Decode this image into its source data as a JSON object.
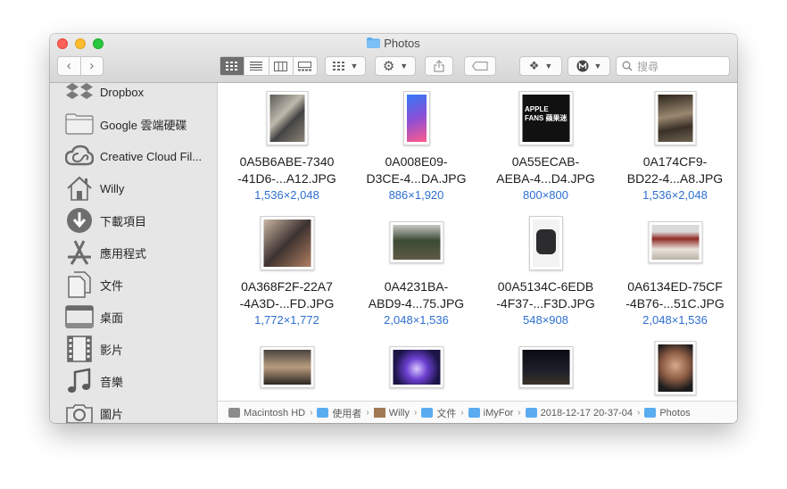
{
  "window": {
    "title": "Photos"
  },
  "toolbar": {
    "back": "‹",
    "forward": "›",
    "search_placeholder": "搜尋"
  },
  "sidebar": {
    "items": [
      {
        "label": "Dropbox",
        "icon": "dropbox-icon"
      },
      {
        "label": "Google 雲端硬碟",
        "icon": "folder-icon"
      },
      {
        "label": "Creative Cloud Fil...",
        "icon": "creative-cloud-icon"
      },
      {
        "label": "Willy",
        "icon": "home-icon"
      },
      {
        "label": "下載項目",
        "icon": "download-icon"
      },
      {
        "label": "應用程式",
        "icon": "applications-icon"
      },
      {
        "label": "文件",
        "icon": "documents-icon"
      },
      {
        "label": "桌面",
        "icon": "desktop-icon"
      },
      {
        "label": "影片",
        "icon": "movies-icon"
      },
      {
        "label": "音樂",
        "icon": "music-icon"
      },
      {
        "label": "圖片",
        "icon": "pictures-icon"
      }
    ]
  },
  "files": [
    {
      "line1": "0A5B6ABE-7340",
      "line2": "-41D6-...A12.JPG",
      "dims": "1,536×2,048"
    },
    {
      "line1": "0A008E09-",
      "line2": "D3CE-4...DA.JPG",
      "dims": "886×1,920"
    },
    {
      "line1": "0A55ECAB-",
      "line2": "AEBA-4...D4.JPG",
      "dims": "800×800",
      "thumb_text": "APPLE FANS 蘋果迷"
    },
    {
      "line1": "0A174CF9-",
      "line2": "BD22-4...A8.JPG",
      "dims": "1,536×2,048"
    },
    {
      "line1": "0A368F2F-22A7",
      "line2": "-4A3D-...FD.JPG",
      "dims": "1,772×1,772"
    },
    {
      "line1": "0A4231BA-",
      "line2": "ABD9-4...75.JPG",
      "dims": "2,048×1,536"
    },
    {
      "line1": "00A5134C-6EDB",
      "line2": "-4F37-...F3D.JPG",
      "dims": "548×908"
    },
    {
      "line1": "0A6134ED-75CF",
      "line2": "-4B76-...51C.JPG",
      "dims": "2,048×1,536"
    },
    {
      "line1": "",
      "line2": "",
      "dims": ""
    },
    {
      "line1": "",
      "line2": "",
      "dims": ""
    },
    {
      "line1": "",
      "line2": "",
      "dims": ""
    },
    {
      "line1": "",
      "line2": "",
      "dims": ""
    }
  ],
  "pathbar": [
    {
      "label": "Macintosh HD",
      "icon": "hard-drive-icon"
    },
    {
      "label": "使用者",
      "icon": "users-folder-icon"
    },
    {
      "label": "Willy",
      "icon": "home-icon"
    },
    {
      "label": "文件",
      "icon": "documents-folder-icon"
    },
    {
      "label": "iMyFor",
      "icon": "folder-icon"
    },
    {
      "label": "2018-12-17 20-37-04",
      "icon": "folder-icon"
    },
    {
      "label": "Photos",
      "icon": "folder-icon"
    }
  ],
  "colors": {
    "accent": "#2e6fd1",
    "folder": "#5aacf0"
  }
}
